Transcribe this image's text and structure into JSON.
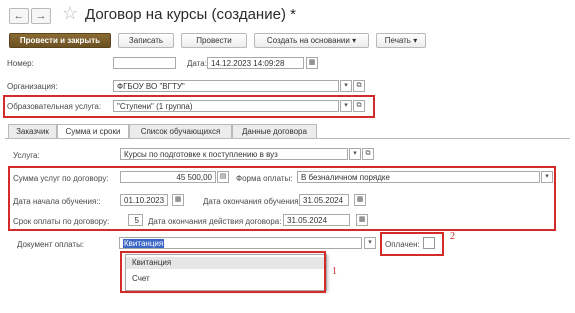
{
  "window": {
    "title": "Договор на курсы (создание) *",
    "nav_back": "←",
    "nav_forward": "→",
    "star": "☆"
  },
  "toolbar": {
    "post_close": "Провести и закрыть",
    "save": "Записать",
    "post": "Провести",
    "create_based": "Создать на основании",
    "print": "Печать"
  },
  "header": {
    "number_label": "Номер:",
    "number_value": "",
    "date_label": "Дата:",
    "date_value": "14.12.2023 14:09:28",
    "org_label": "Организация:",
    "org_value": "ФГБОУ ВО \"ВГТУ\"",
    "service_label": "Образовательная услуга:",
    "service_value": "\"Ступени\" (1 группа)"
  },
  "tabs": [
    {
      "label": "Заказчик"
    },
    {
      "label": "Сумма и сроки"
    },
    {
      "label": "Список обучающихся"
    },
    {
      "label": "Данные договора"
    }
  ],
  "form": {
    "usluga_label": "Услуга:",
    "usluga_value": "Курсы по подготовке к поступлению в вуз",
    "sum_label": "Сумма услуг по договору:",
    "sum_value": "45 500,00",
    "payment_form_label": "Форма оплаты:",
    "payment_form_value": "В безналичном порядке",
    "start_label": "Дата начала обучения::",
    "start_value": "01.10.2023",
    "end_label": "Дата окончания обучения::",
    "end_value": "31.05.2024",
    "term_label": "Срок оплаты по договору:",
    "term_value": "5",
    "valid_label": "Дата окончания действия договора:",
    "valid_value": "31.05.2024",
    "doc_label": "Документ оплаты:",
    "doc_value": "Квитанция",
    "paid_label": "Оплачен:"
  },
  "dropdown": {
    "options": [
      "Квитанция",
      "Счет"
    ]
  },
  "annotations": {
    "one": "1",
    "two": "2"
  },
  "colors": {
    "primary_button": "#7a5d2b",
    "annotation_red": "#d32a2a",
    "selection_blue": "#3a66c6"
  }
}
